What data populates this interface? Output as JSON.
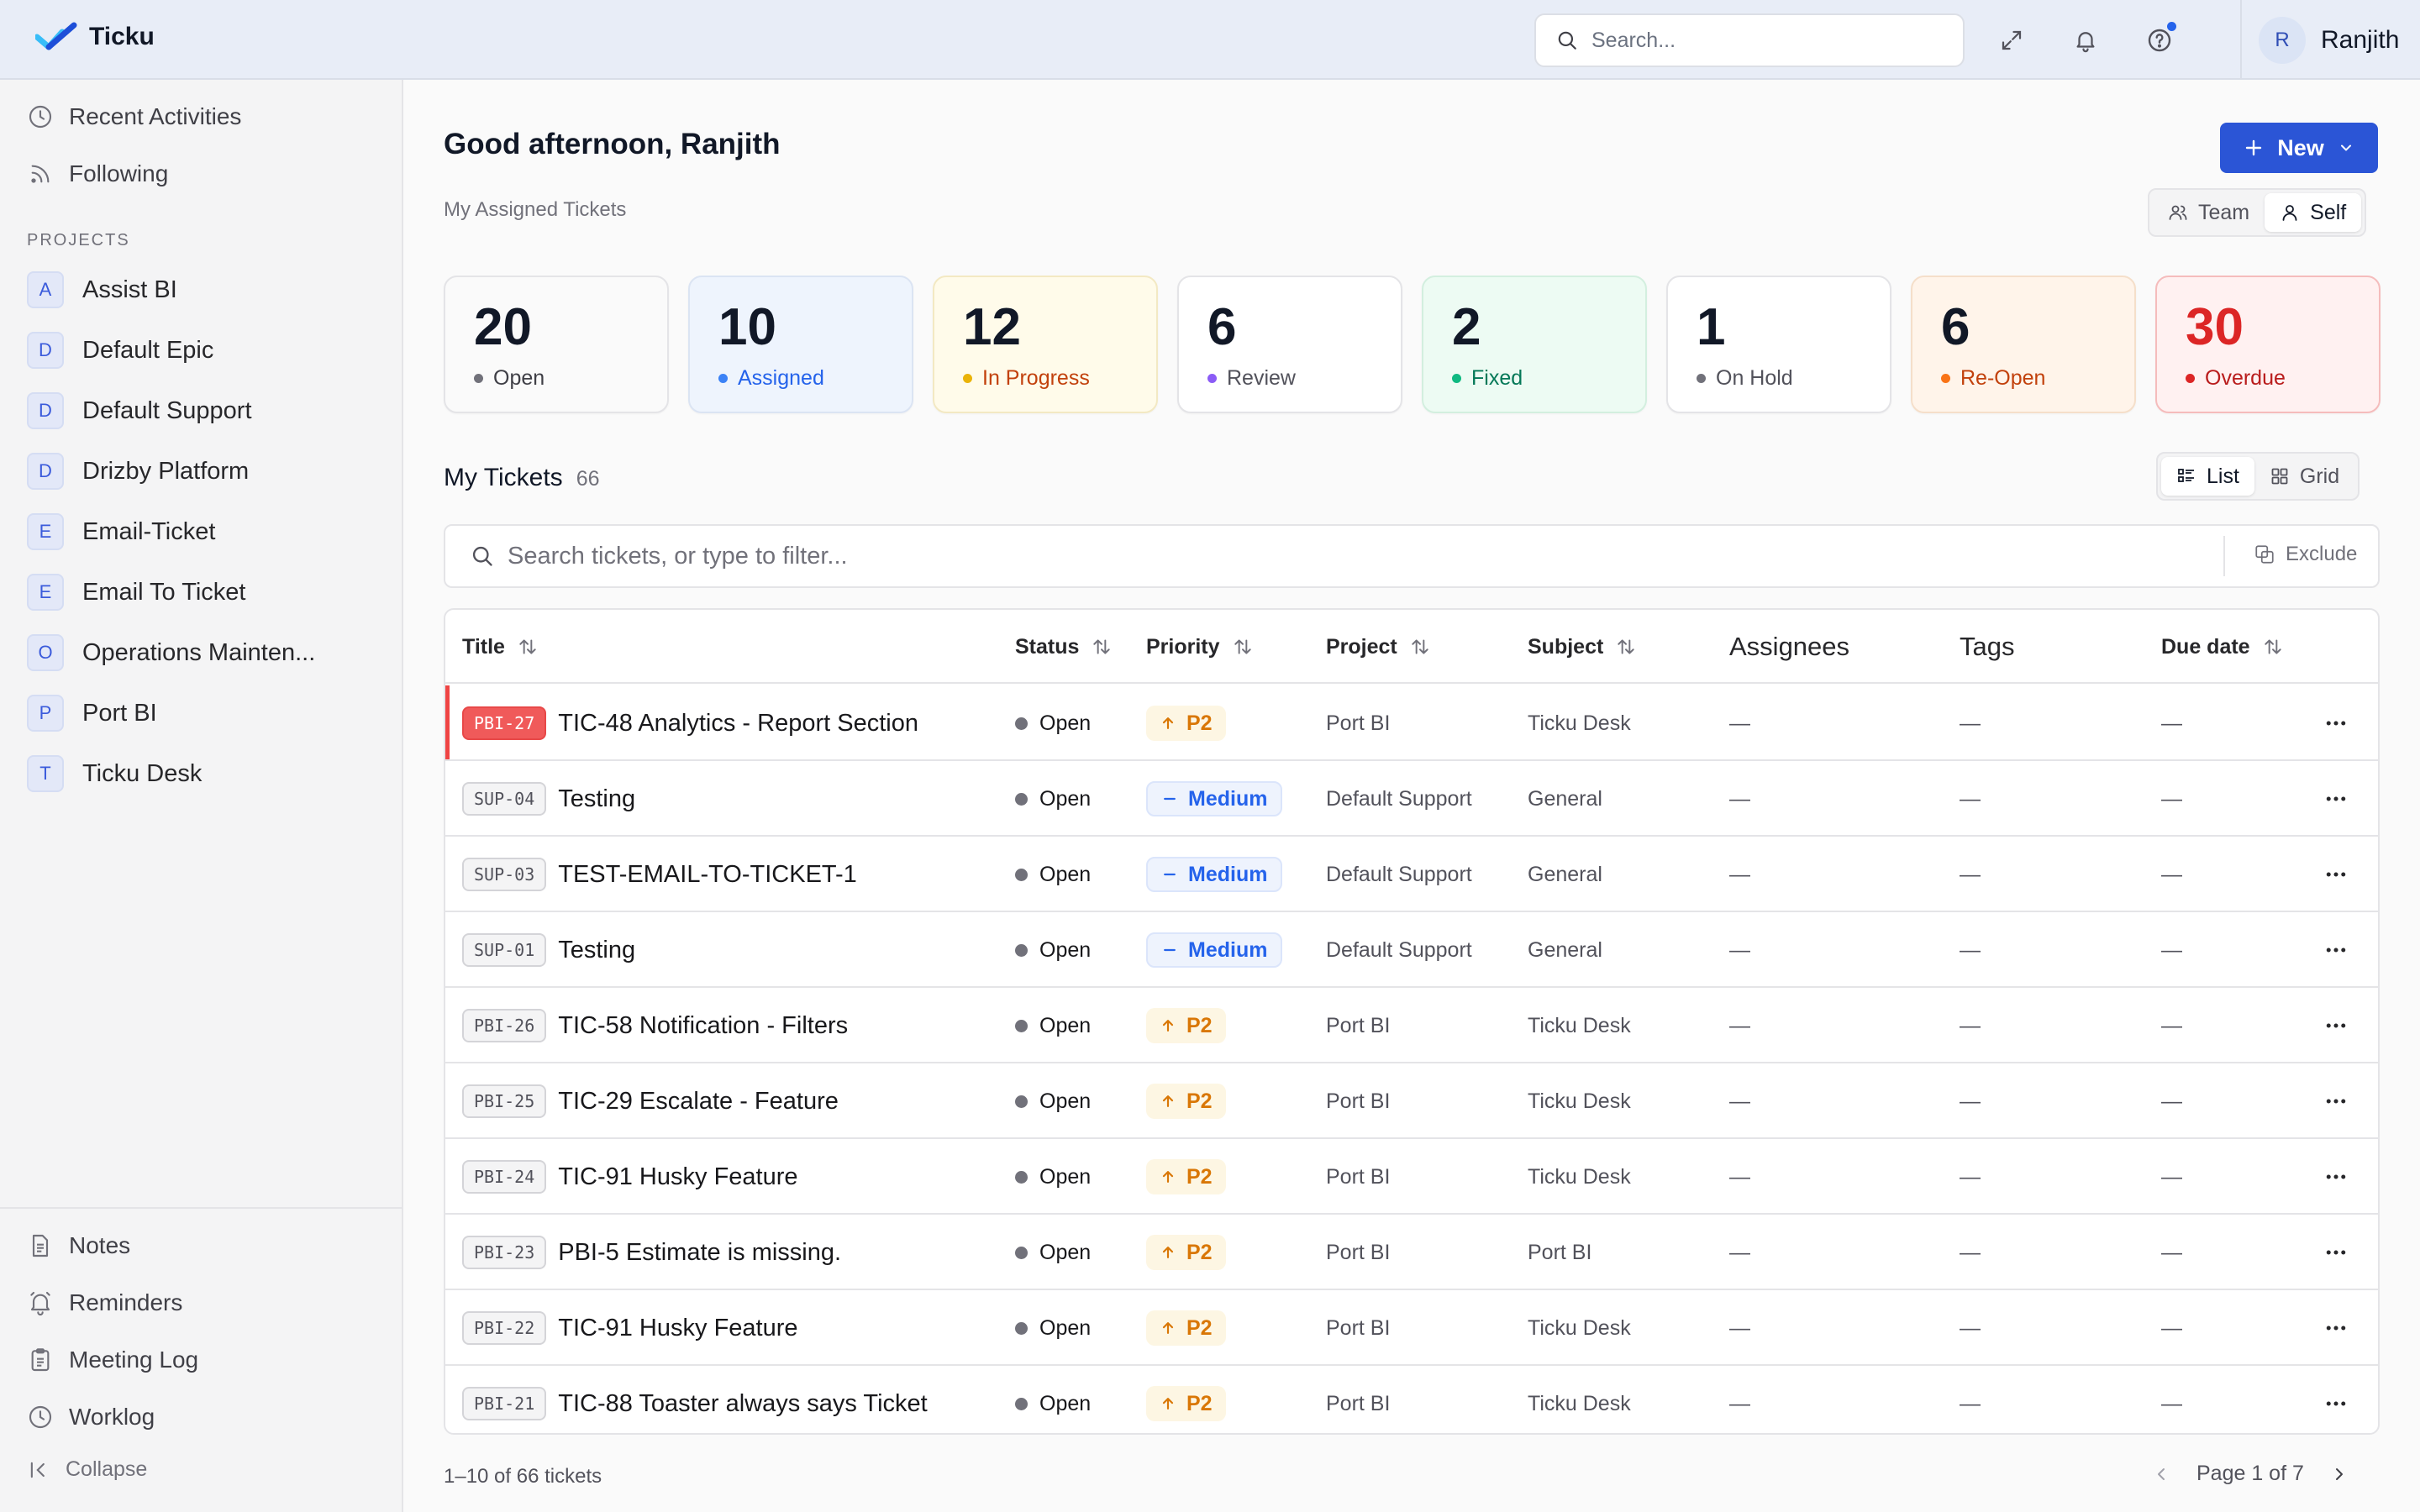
{
  "brand": {
    "name": "Ticku"
  },
  "topbar": {
    "search_placeholder": "Search...",
    "user": {
      "initial": "R",
      "name": "Ranjith"
    }
  },
  "sidebar": {
    "top_items": [
      {
        "label": "Recent Activities",
        "icon": "clock-icon"
      },
      {
        "label": "Following",
        "icon": "rss-icon"
      }
    ],
    "projects_label": "PROJECTS",
    "projects": [
      {
        "initial": "A",
        "name": "Assist BI"
      },
      {
        "initial": "D",
        "name": "Default Epic"
      },
      {
        "initial": "D",
        "name": "Default Support"
      },
      {
        "initial": "D",
        "name": "Drizby Platform"
      },
      {
        "initial": "E",
        "name": "Email-Ticket"
      },
      {
        "initial": "E",
        "name": "Email To Ticket"
      },
      {
        "initial": "O",
        "name": "Operations Mainten..."
      },
      {
        "initial": "P",
        "name": "Port BI"
      },
      {
        "initial": "T",
        "name": "Ticku Desk"
      }
    ],
    "bottom_items": [
      {
        "label": "Notes",
        "icon": "notes-icon"
      },
      {
        "label": "Reminders",
        "icon": "bell-icon"
      },
      {
        "label": "Meeting Log",
        "icon": "clipboard-icon"
      },
      {
        "label": "Worklog",
        "icon": "clock-icon"
      }
    ],
    "collapse_label": "Collapse"
  },
  "main": {
    "greeting": "Good afternoon, Ranjith",
    "subtitle": "My Assigned Tickets",
    "new_button": "New",
    "scope": {
      "team": "Team",
      "self": "Self",
      "active": "self"
    },
    "stats": [
      {
        "value": "20",
        "label": "Open",
        "bg": "#fafafa",
        "border": "#e4e4e7",
        "text": "#3f3f46",
        "dot": "#71717a",
        "valueColor": "#111827"
      },
      {
        "value": "10",
        "label": "Assigned",
        "bg": "#eef4fd",
        "border": "#dbe4f3",
        "text": "#2563eb",
        "dot": "#3b82f6",
        "valueColor": "#111827"
      },
      {
        "value": "12",
        "label": "In Progress",
        "bg": "#fffbea",
        "border": "#f3e9c3",
        "text": "#c2410c",
        "dot": "#eab308",
        "valueColor": "#111827"
      },
      {
        "value": "6",
        "label": "Review",
        "bg": "#ffffff",
        "border": "#e4e4e7",
        "text": "#52525b",
        "dot": "#8b5cf6",
        "valueColor": "#111827"
      },
      {
        "value": "2",
        "label": "Fixed",
        "bg": "#edfbf3",
        "border": "#d3efdf",
        "text": "#047857",
        "dot": "#10b981",
        "valueColor": "#111827"
      },
      {
        "value": "1",
        "label": "On Hold",
        "bg": "#ffffff",
        "border": "#e4e4e7",
        "text": "#52525b",
        "dot": "#71717a",
        "valueColor": "#111827"
      },
      {
        "value": "6",
        "label": "Re-Open",
        "bg": "#fff4ea",
        "border": "#f5dfca",
        "text": "#c2410c",
        "dot": "#f97316",
        "valueColor": "#111827"
      },
      {
        "value": "30",
        "label": "Overdue",
        "bg": "#fff1f1",
        "border": "#f5bcbc",
        "text": "#b91c1c",
        "dot": "#dc2626",
        "valueColor": "#dc2626"
      }
    ],
    "tickets": {
      "title": "My Tickets",
      "count": "66",
      "view": {
        "list": "List",
        "grid": "Grid",
        "active": "list"
      },
      "filter_placeholder": "Search tickets, or type to filter...",
      "exclude_label": "Exclude",
      "columns": {
        "title": "Title",
        "status": "Status",
        "priority": "Priority",
        "project": "Project",
        "subject": "Subject",
        "assignees": "Assignees",
        "tags": "Tags",
        "due": "Due date"
      },
      "rows": [
        {
          "code": "PBI-27",
          "title": "TIC-48 Analytics - Report Section",
          "status": "Open",
          "priority": "P2",
          "ptype": "p2",
          "project": "Port BI",
          "subject": "Ticku Desk",
          "assignees": "—",
          "tags": "—",
          "due": "—",
          "flagged": true
        },
        {
          "code": "SUP-04",
          "title": "Testing",
          "status": "Open",
          "priority": "Medium",
          "ptype": "med",
          "project": "Default Support",
          "subject": "General",
          "assignees": "—",
          "tags": "—",
          "due": "—",
          "flagged": false
        },
        {
          "code": "SUP-03",
          "title": "TEST-EMAIL-TO-TICKET-1",
          "status": "Open",
          "priority": "Medium",
          "ptype": "med",
          "project": "Default Support",
          "subject": "General",
          "assignees": "—",
          "tags": "—",
          "due": "—",
          "flagged": false
        },
        {
          "code": "SUP-01",
          "title": "Testing",
          "status": "Open",
          "priority": "Medium",
          "ptype": "med",
          "project": "Default Support",
          "subject": "General",
          "assignees": "—",
          "tags": "—",
          "due": "—",
          "flagged": false
        },
        {
          "code": "PBI-26",
          "title": "TIC-58 Notification - Filters",
          "status": "Open",
          "priority": "P2",
          "ptype": "p2",
          "project": "Port BI",
          "subject": "Ticku Desk",
          "assignees": "—",
          "tags": "—",
          "due": "—",
          "flagged": false
        },
        {
          "code": "PBI-25",
          "title": "TIC-29 Escalate - Feature",
          "status": "Open",
          "priority": "P2",
          "ptype": "p2",
          "project": "Port BI",
          "subject": "Ticku Desk",
          "assignees": "—",
          "tags": "—",
          "due": "—",
          "flagged": false
        },
        {
          "code": "PBI-24",
          "title": "TIC-91 Husky Feature",
          "status": "Open",
          "priority": "P2",
          "ptype": "p2",
          "project": "Port BI",
          "subject": "Ticku Desk",
          "assignees": "—",
          "tags": "—",
          "due": "—",
          "flagged": false
        },
        {
          "code": "PBI-23",
          "title": "PBI-5 Estimate is missing.",
          "status": "Open",
          "priority": "P2",
          "ptype": "p2",
          "project": "Port BI",
          "subject": "Port BI",
          "assignees": "—",
          "tags": "—",
          "due": "—",
          "flagged": false
        },
        {
          "code": "PBI-22",
          "title": "TIC-91 Husky Feature",
          "status": "Open",
          "priority": "P2",
          "ptype": "p2",
          "project": "Port BI",
          "subject": "Ticku Desk",
          "assignees": "—",
          "tags": "—",
          "due": "—",
          "flagged": false
        },
        {
          "code": "PBI-21",
          "title": "TIC-88 Toaster always says Ticket",
          "status": "Open",
          "priority": "P2",
          "ptype": "p2",
          "project": "Port BI",
          "subject": "Ticku Desk",
          "assignees": "—",
          "tags": "—",
          "due": "—",
          "flagged": false
        }
      ],
      "range_text": "1–10 of 66 tickets",
      "page_text": "Page 1 of 7"
    }
  }
}
